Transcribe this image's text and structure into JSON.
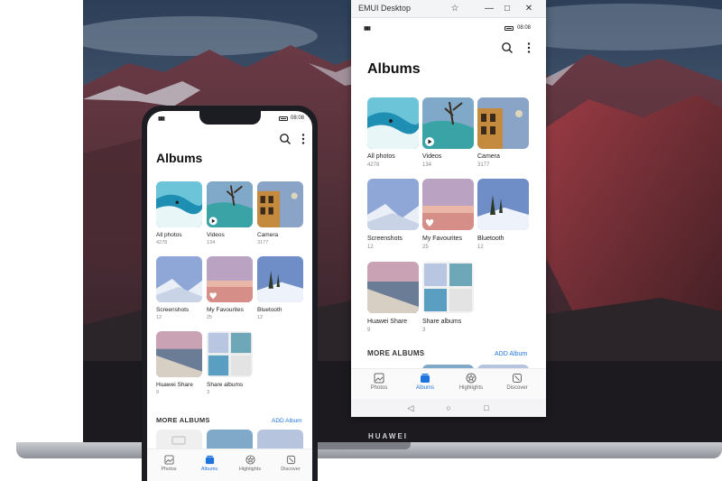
{
  "window": {
    "title": "EMUI Desktop",
    "pin_icon": "pin-icon",
    "min_icon": "minimize-icon",
    "max_icon": "maximize-icon",
    "close_icon": "close-icon"
  },
  "laptop": {
    "brand": "HUAWEI"
  },
  "status": {
    "time": "08:08"
  },
  "header": {
    "title": "Albums",
    "search_icon": "search-icon",
    "more_icon": "more-vert-icon"
  },
  "albums": [
    {
      "name": "All photos",
      "count": "4278"
    },
    {
      "name": "Videos",
      "count": "134"
    },
    {
      "name": "Camera",
      "count": "3177"
    },
    {
      "name": "Screenshots",
      "count": "12"
    },
    {
      "name": "My Favourites",
      "count": "25"
    },
    {
      "name": "Bluetooth",
      "count": "12"
    },
    {
      "name": "Huawei Share",
      "count": "9"
    },
    {
      "name": "Share albums",
      "count": "3"
    }
  ],
  "more_albums": {
    "label": "MORE ALBUMS",
    "phone_add": "ADD Album",
    "pc_add": "ADD Album"
  },
  "tabs": [
    {
      "label": "Photos",
      "icon": "photos-icon"
    },
    {
      "label": "Albums",
      "icon": "albums-icon",
      "active": true
    },
    {
      "label": "Highlights",
      "icon": "star-icon"
    },
    {
      "label": "Discover",
      "icon": "discover-icon"
    }
  ],
  "colors": {
    "accent": "#1e74dd",
    "text": "#111111",
    "muted": "#888888"
  }
}
